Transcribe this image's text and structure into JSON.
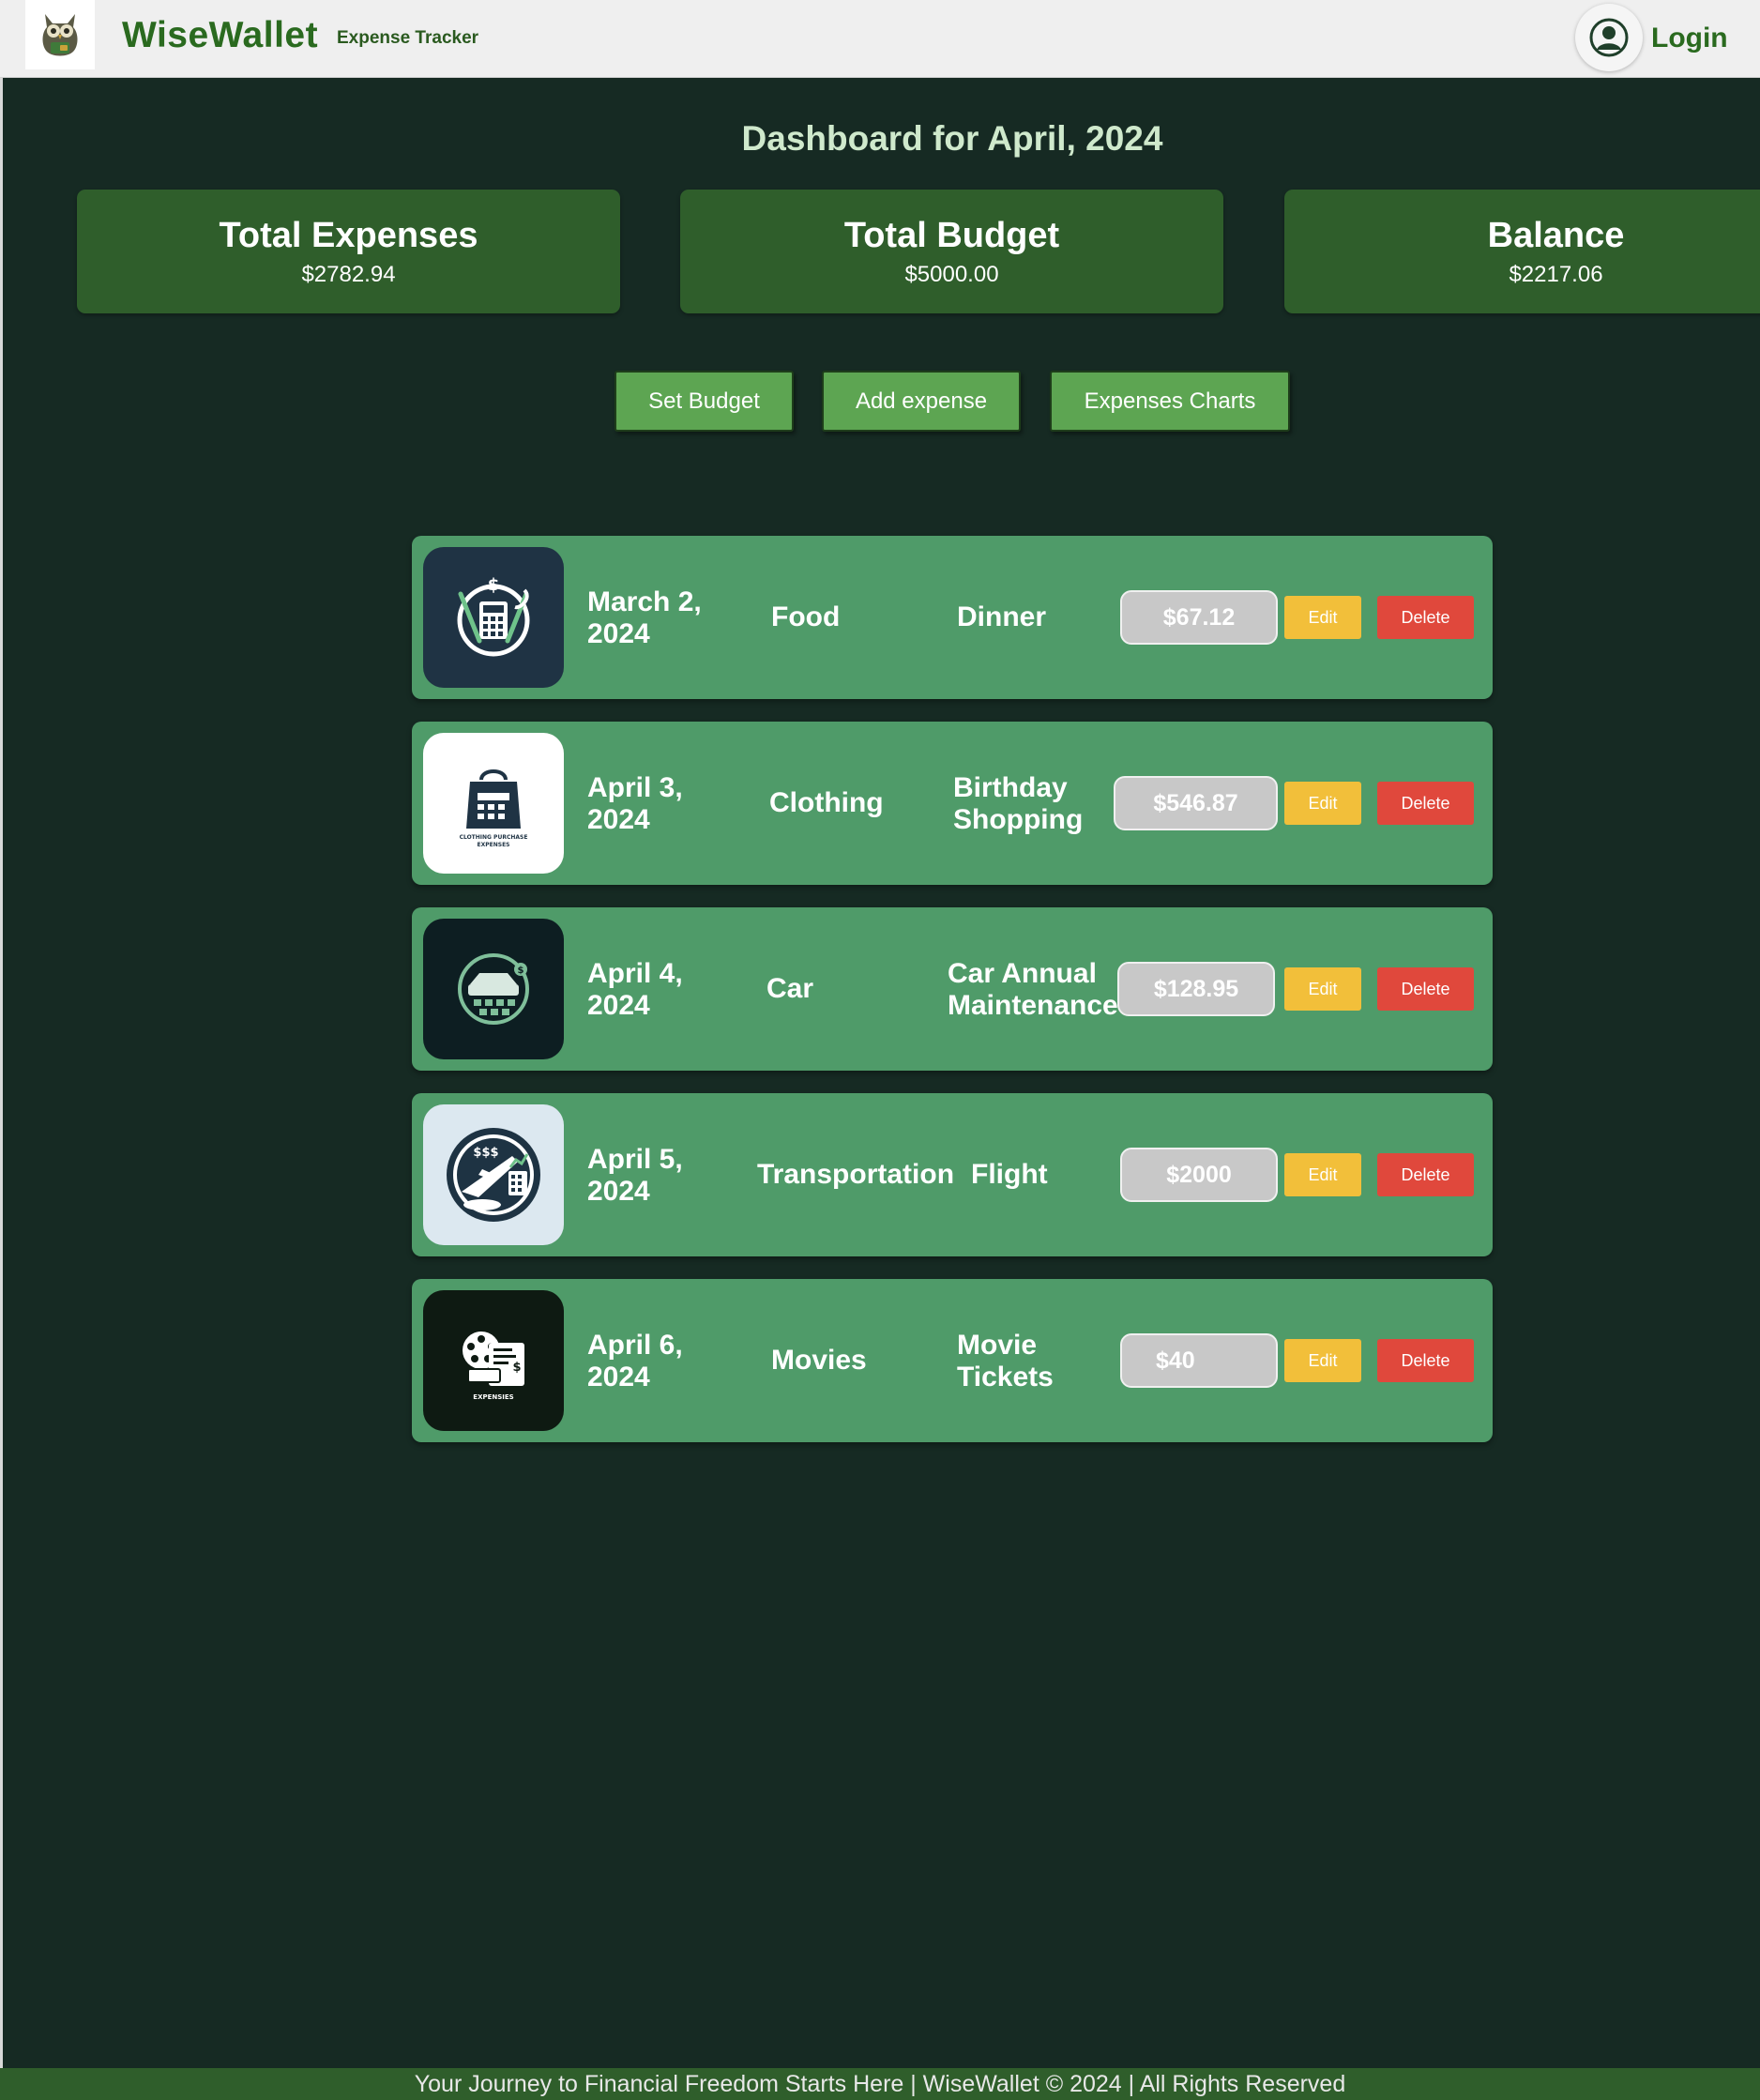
{
  "header": {
    "brand": "WiseWallet",
    "tagline": "Expense Tracker",
    "login_label": "Login",
    "logo_icon": "owl-wallet-icon",
    "login_icon": "user-avatar-icon"
  },
  "dashboard": {
    "title": "Dashboard for April, 2024"
  },
  "summary": {
    "total_expenses_label": "Total Expenses",
    "total_expenses_value": "$2782.94",
    "total_budget_label": "Total Budget",
    "total_budget_value": "$5000.00",
    "balance_label": "Balance",
    "balance_value": "$2217.06"
  },
  "actions": {
    "set_budget": "Set Budget",
    "add_expense": "Add expense",
    "expenses_charts": "Expenses Charts"
  },
  "expenses": [
    {
      "date_line1": "March 2,",
      "date_line2": "2024",
      "category": "Food",
      "desc_line1": "Dinner",
      "desc_line2": "",
      "amount": "$67.12",
      "edit": "Edit",
      "delete": "Delete",
      "icon": "food-expense-icon"
    },
    {
      "date_line1": "April 3,",
      "date_line2": "2024",
      "category": "Clothing",
      "desc_line1": "Birthday",
      "desc_line2": "Shopping",
      "amount": "$546.87",
      "edit": "Edit",
      "delete": "Delete",
      "icon": "clothing-expense-icon",
      "icon_text_1": "CLOTHING PURCHASE",
      "icon_text_2": "EXPENSES"
    },
    {
      "date_line1": "April 4,",
      "date_line2": "2024",
      "category": "Car",
      "desc_line1": "Car Annual",
      "desc_line2": "Maintenance",
      "amount": "$128.95",
      "edit": "Edit",
      "delete": "Delete",
      "icon": "car-expense-icon"
    },
    {
      "date_line1": "April 5,",
      "date_line2": "2024",
      "category": "Transportation",
      "desc_line1": "Flight",
      "desc_line2": "",
      "amount": "$2000",
      "edit": "Edit",
      "delete": "Delete",
      "icon": "flight-expense-icon"
    },
    {
      "date_line1": "April 6,",
      "date_line2": "2024",
      "category": "Movies",
      "desc_line1": "Movie",
      "desc_line2": "Tickets",
      "amount": "$40",
      "edit": "Edit",
      "delete": "Delete",
      "icon": "movie-expense-icon",
      "icon_text_1": "EXPENSIES"
    }
  ],
  "footer": {
    "text": "Your Journey to Financial Freedom Starts Here | WiseWallet © 2024 | All Rights Reserved"
  },
  "colors": {
    "background": "#162a23",
    "card": "#2f5e2b",
    "row": "#4f9b69",
    "button": "#5da552",
    "edit": "#f2bf3a",
    "delete": "#e0483c",
    "brand": "#2a6a1f"
  }
}
